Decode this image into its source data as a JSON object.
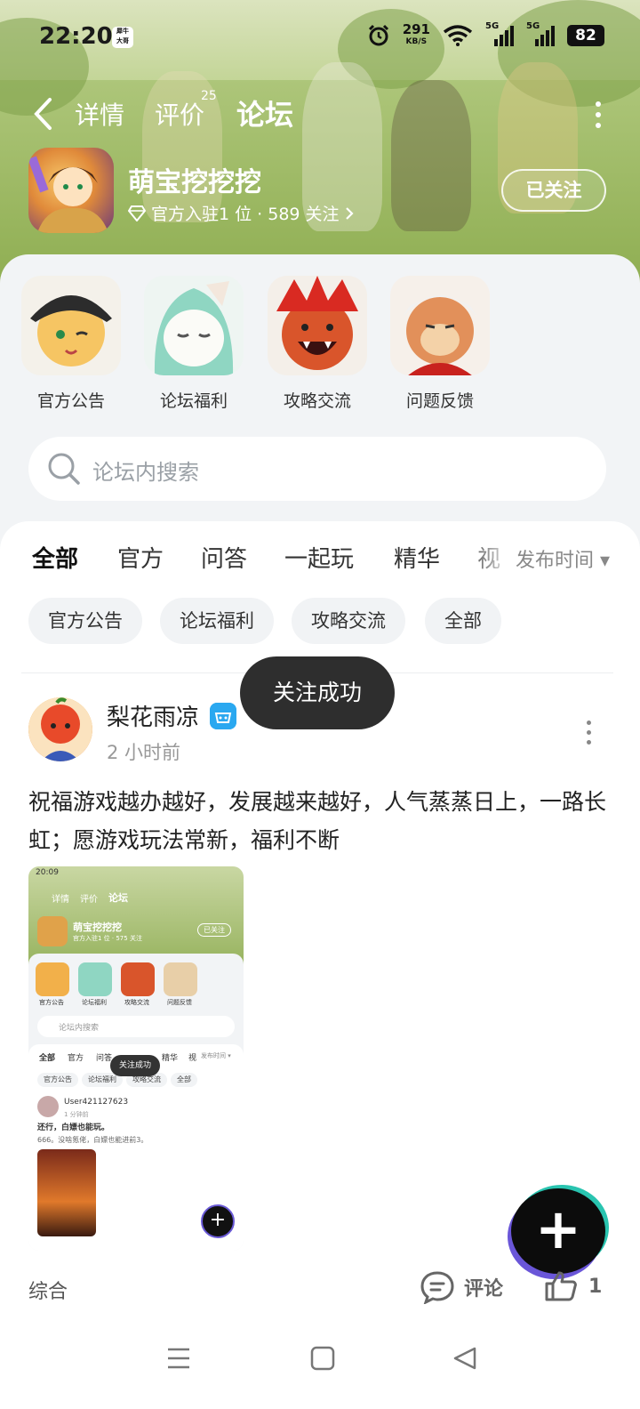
{
  "status_bar": {
    "time": "22:20",
    "carrier_badge": "犀牛\n大哥",
    "net_speed_value": "291",
    "net_speed_unit": "KB/S",
    "sim1": "5G",
    "sim2": "5G",
    "battery": "82"
  },
  "nav": {
    "tabs": [
      {
        "label": "详情"
      },
      {
        "label": "评价"
      },
      {
        "label": "论坛"
      }
    ],
    "review_count": "25",
    "active_tab": "论坛"
  },
  "game": {
    "name": "萌宝挖挖挖",
    "meta": "官方入驻1 位 · 589 关注",
    "follow_button": "已关注"
  },
  "boards": [
    {
      "label": "官方公告",
      "color": "#f2b04a"
    },
    {
      "label": "论坛福利",
      "color": "#8fd6c2"
    },
    {
      "label": "攻略交流",
      "color": "#d9552b"
    },
    {
      "label": "问题反馈",
      "color": "#e8cfa8"
    }
  ],
  "search": {
    "placeholder": "论坛内搜索"
  },
  "filter": {
    "tabs": [
      {
        "label": "全部"
      },
      {
        "label": "官方"
      },
      {
        "label": "问答"
      },
      {
        "label": "一起玩"
      },
      {
        "label": "精华"
      },
      {
        "label": "视"
      }
    ],
    "sort_label": "发布时间 ▾",
    "chips": [
      {
        "label": "官方公告"
      },
      {
        "label": "论坛福利"
      },
      {
        "label": "攻略交流"
      },
      {
        "label": "全部"
      }
    ]
  },
  "toast": "关注成功",
  "post": {
    "username": "梨花雨凉",
    "time": "2 小时前",
    "content": "祝福游戏越办越好，发展越来越好，人气蒸蒸日上，一路长虹；愿游戏玩法常新，福利不断",
    "screenshot": {
      "time": "20:09",
      "tabs": [
        "详情",
        "评价",
        "论坛"
      ],
      "game_name": "萌宝挖挖挖",
      "game_meta": "官方入驻1 位 · 575 关注",
      "follow": "已关注",
      "boards": [
        "官方公告",
        "论坛福利",
        "攻略交流",
        "问题反馈"
      ],
      "search": "论坛内搜索",
      "filter_tabs": [
        "全部",
        "官方",
        "问答",
        "精华",
        "视"
      ],
      "sort": "发布时间 ▾",
      "chips": [
        "官方公告",
        "论坛福利",
        "攻略交流",
        "全部"
      ],
      "toast": "关注成功",
      "user": "User421127623",
      "user_time": "1 分钟前",
      "title": "还行，白嫖也能玩。",
      "body": "666。没啥氪佬，白嫖也能进前3。"
    }
  },
  "bottom": {
    "left_label": "综合",
    "comment_label": "评论",
    "like_count": "1"
  },
  "colors": {
    "accent": "#3fd6b4",
    "hero": "#a6c070",
    "panel": "#f2f4f6"
  }
}
